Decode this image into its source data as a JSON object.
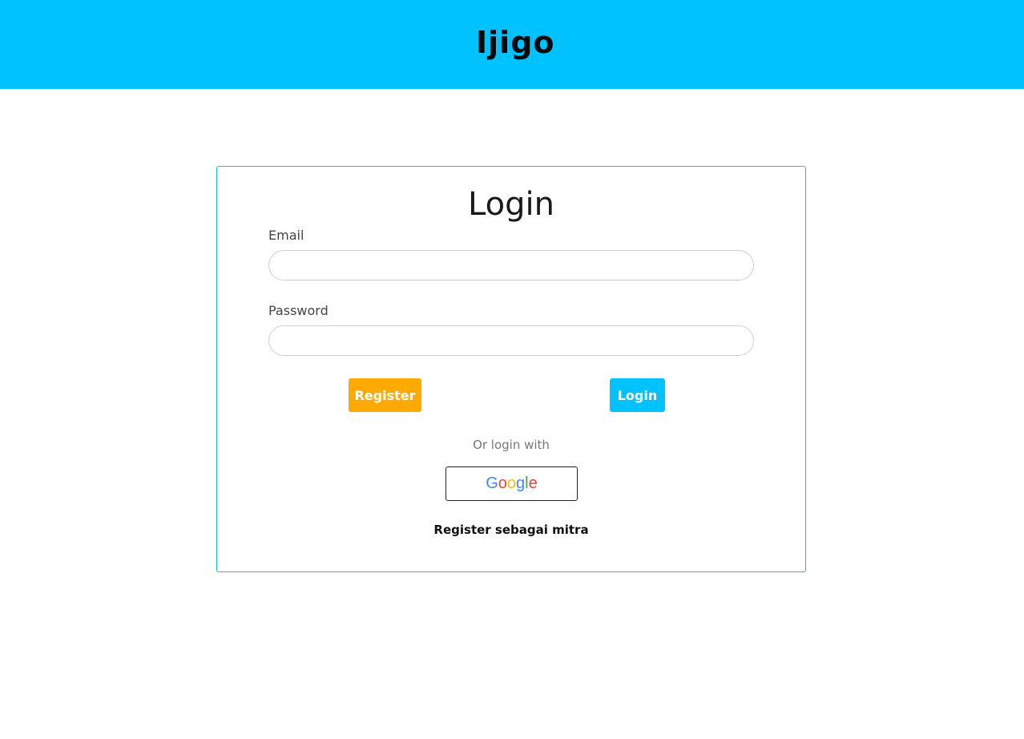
{
  "header": {
    "logo_text": "Ijigo",
    "background_color": "#00c2ff"
  },
  "login_card": {
    "title": "Login",
    "email": {
      "label": "Email",
      "value": "",
      "placeholder": ""
    },
    "password": {
      "label": "Password",
      "value": "",
      "placeholder": ""
    },
    "register_button_label": "Register",
    "login_button_label": "Login",
    "or_text": "Or login with",
    "google_button": {
      "letters": [
        "G",
        "o",
        "o",
        "g",
        "l",
        "e"
      ],
      "icon": "google-logo"
    },
    "mitra_link_label": "Register sebagai mitra"
  },
  "colors": {
    "accent": "#00c2ff",
    "register_button": "#ffaa00",
    "login_button": "#00c2ff"
  }
}
